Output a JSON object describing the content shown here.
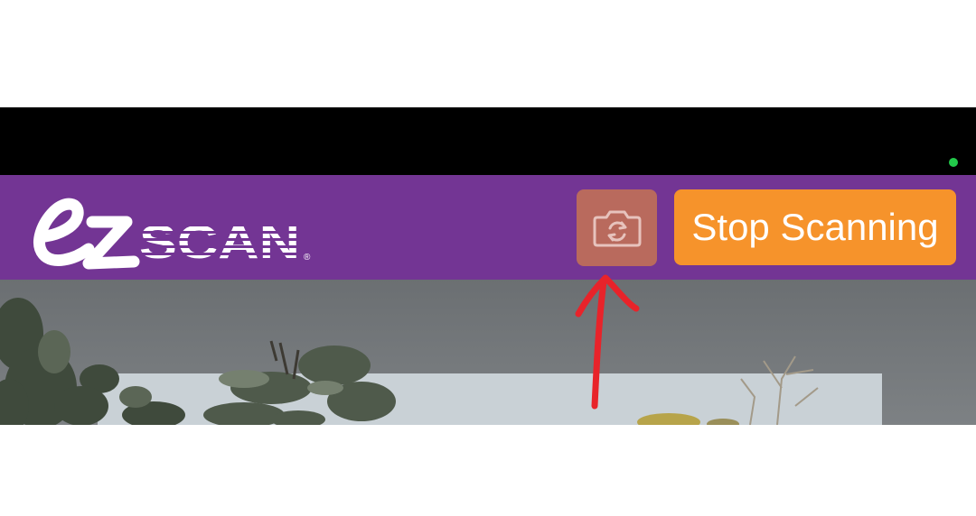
{
  "header": {
    "brand_color": "#733594",
    "logo": {
      "name": "ezSCAN",
      "registered_mark": "®"
    },
    "camera_switch": {
      "icon": "camera-flip-icon",
      "color": "#b96a5d"
    },
    "stop_button": {
      "label": "Stop Scanning",
      "color": "#f6932b"
    }
  },
  "status_bar": {
    "indicator_color": "#22c94a"
  },
  "annotation": {
    "type": "hand-drawn-arrow",
    "color": "#e8232a",
    "points_to": "camera_switch"
  }
}
